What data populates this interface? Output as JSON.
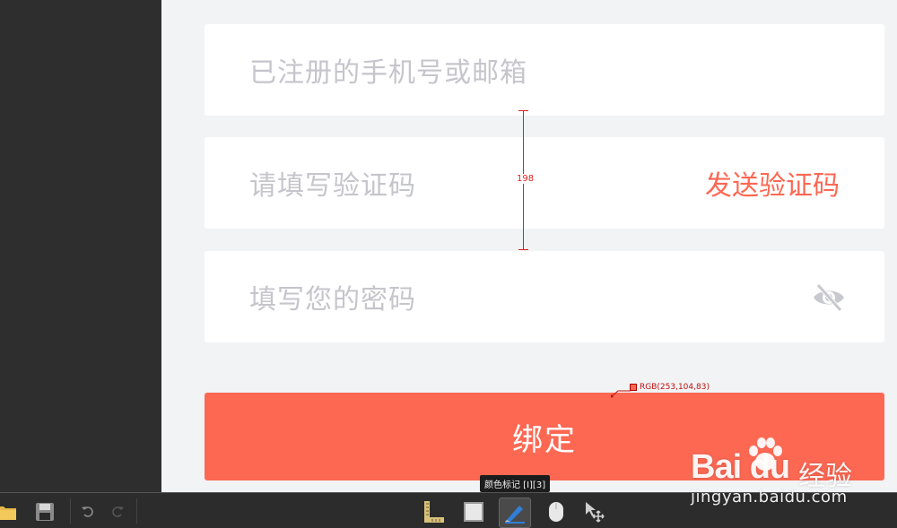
{
  "form": {
    "account_placeholder": "已注册的手机号或邮箱",
    "code_placeholder": "请填写验证码",
    "send_code_label": "发送验证码",
    "password_placeholder": "填写您的密码",
    "bind_button_label": "绑定"
  },
  "annotations": {
    "distance_label": "198",
    "color_pick_label": "RGB(253,104,83)"
  },
  "toolbar": {
    "tooltip": "颜色标记 [I][3]",
    "tools": [
      "folder-icon",
      "save-icon",
      "undo-icon",
      "redo-icon",
      "ruler-icon",
      "rectangle-icon",
      "color-marker-icon",
      "mouse-icon",
      "move-icon"
    ],
    "active_tool": "color-marker-icon"
  },
  "watermark": {
    "logo_text": "Bai du",
    "logo_cn": "经验",
    "url": "jingyan.baidu.com"
  },
  "colors": {
    "accent": "#fd6853",
    "placeholder": "#c5c5cc",
    "background": "#f2f3f5",
    "sidebar": "#2e2e2e",
    "toolbar": "#2c2c2c"
  }
}
